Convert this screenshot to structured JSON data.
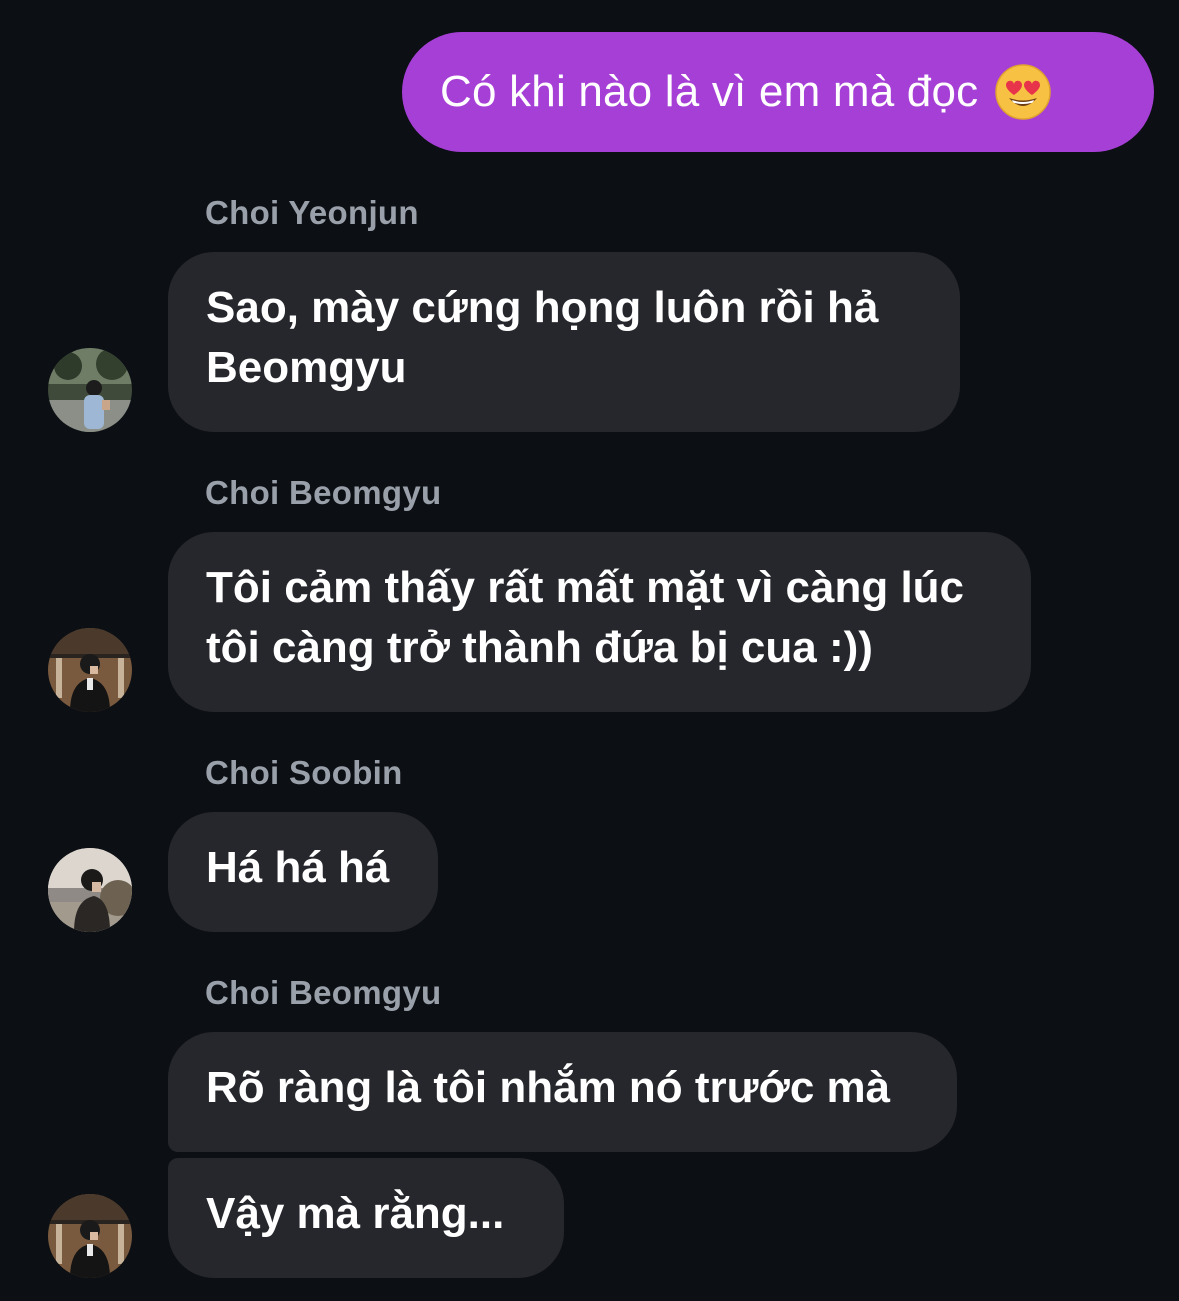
{
  "outgoing": {
    "text": "Có khi nào là vì em mà đọc",
    "emoji": "heart-eyes-emoji",
    "color": "#a63fd6"
  },
  "messages": [
    {
      "sender": "Choi Yeonjun",
      "text": "Sao, mày cứng họng luôn rồi hả Beomgyu",
      "avatar": "yeonjun-avatar"
    },
    {
      "sender": "Choi Beomgyu",
      "text": "Tôi cảm thấy rất mất mặt vì càng lúc tôi càng trở thành đứa bị cua :))",
      "avatar": "beomgyu-avatar"
    },
    {
      "sender": "Choi Soobin",
      "text": "Há há há",
      "avatar": "soobin-avatar"
    },
    {
      "sender": "Choi Beomgyu",
      "texts": [
        "Rõ ràng là tôi nhắm nó trước mà",
        "Vậy mà rằng..."
      ],
      "avatar": "beomgyu-avatar"
    }
  ],
  "colors": {
    "background": "#0c0f14",
    "bubble": "#25272c",
    "sender": "#9aa0a9"
  }
}
